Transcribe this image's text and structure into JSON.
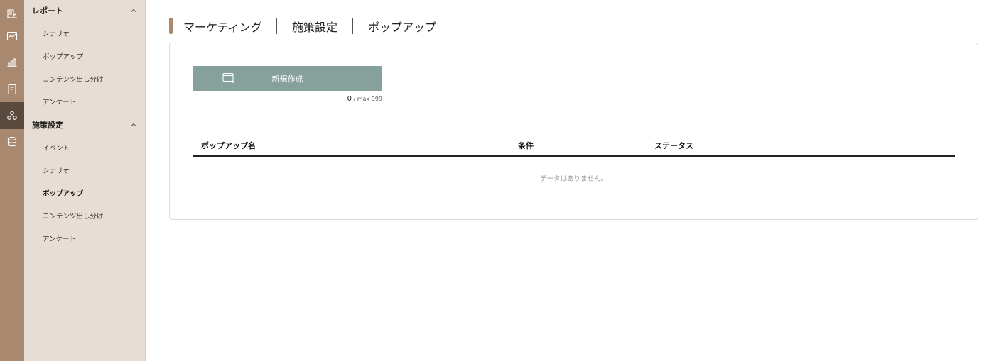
{
  "rail": {
    "items": [
      {
        "icon": "building-chart-icon"
      },
      {
        "icon": "line-chart-icon"
      },
      {
        "icon": "bar-chart-icon"
      },
      {
        "icon": "document-icon"
      },
      {
        "icon": "scatter-network-icon",
        "active": true
      },
      {
        "icon": "database-icon"
      }
    ]
  },
  "sidebar": {
    "report": {
      "title": "レポート",
      "items": [
        "シナリオ",
        "ポップアップ",
        "コンテンツ出し分け",
        "アンケート"
      ]
    },
    "measures": {
      "title": "施策設定",
      "items": [
        "イベント",
        "シナリオ",
        "ポップアップ",
        "コンテンツ出し分け",
        "アンケート"
      ],
      "active": "ポップアップ"
    }
  },
  "breadcrumb": [
    "マーケティング",
    "施策設定",
    "ポップアップ"
  ],
  "toolbar": {
    "new_label": "新規作成",
    "count": "0",
    "max": " / max 999"
  },
  "table": {
    "columns": [
      "ポップアップ名",
      "条件",
      "ステータス"
    ],
    "empty_text": "データはありません。"
  },
  "colors": {
    "rail": "#a8896f",
    "rail_active": "#5a4a3d",
    "sidebar": "#e8ddd4",
    "button": "#86a19c"
  }
}
